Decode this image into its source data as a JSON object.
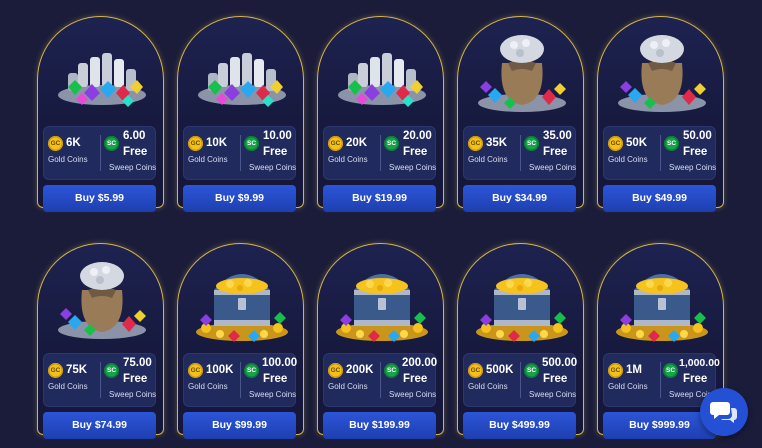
{
  "packages": [
    {
      "gc_amount": "6K",
      "gc_label": "Gold Coins",
      "sc_amount": "6.00",
      "sc_free": "Free",
      "sc_label": "Sweep Coins",
      "buy_label": "Buy $5.99",
      "art": "gems-pile"
    },
    {
      "gc_amount": "10K",
      "gc_label": "Gold Coins",
      "sc_amount": "10.00",
      "sc_free": "Free",
      "sc_label": "Sweep Coins",
      "buy_label": "Buy $9.99",
      "art": "gems-pile"
    },
    {
      "gc_amount": "20K",
      "gc_label": "Gold Coins",
      "sc_amount": "20.00",
      "sc_free": "Free",
      "sc_label": "Sweep Coins",
      "buy_label": "Buy $19.99",
      "art": "gems-pile"
    },
    {
      "gc_amount": "35K",
      "gc_label": "Gold Coins",
      "sc_amount": "35.00",
      "sc_free": "Free",
      "sc_label": "Sweep Coins",
      "buy_label": "Buy $34.99",
      "art": "gem-sack"
    },
    {
      "gc_amount": "50K",
      "gc_label": "Gold Coins",
      "sc_amount": "50.00",
      "sc_free": "Free",
      "sc_label": "Sweep Coins",
      "buy_label": "Buy $49.99",
      "art": "gem-sack"
    },
    {
      "gc_amount": "75K",
      "gc_label": "Gold Coins",
      "sc_amount": "75.00",
      "sc_free": "Free",
      "sc_label": "Sweep Coins",
      "buy_label": "Buy $74.99",
      "art": "gem-sack"
    },
    {
      "gc_amount": "100K",
      "gc_label": "Gold Coins",
      "sc_amount": "100.00",
      "sc_free": "Free",
      "sc_label": "Sweep Coins",
      "buy_label": "Buy $99.99",
      "art": "treasure-chest"
    },
    {
      "gc_amount": "200K",
      "gc_label": "Gold Coins",
      "sc_amount": "200.00",
      "sc_free": "Free",
      "sc_label": "Sweep Coins",
      "buy_label": "Buy $199.99",
      "art": "treasure-chest"
    },
    {
      "gc_amount": "500K",
      "gc_label": "Gold Coins",
      "sc_amount": "500.00",
      "sc_free": "Free",
      "sc_label": "Sweep Coins",
      "buy_label": "Buy $499.99",
      "art": "treasure-chest"
    },
    {
      "gc_amount": "1M",
      "gc_label": "Gold Coins",
      "sc_amount": "1,000.00",
      "sc_free": "Free",
      "sc_label": "Sweep Coins",
      "buy_label": "Buy $999.99",
      "art": "treasure-chest"
    }
  ],
  "coin_badges": {
    "gold": "GC",
    "sweep": "SC"
  },
  "chat_button": {
    "icon": "chat-bubbles-icon"
  },
  "colors": {
    "background": "#1a1c3a",
    "card_border": "#d6b64a",
    "buy_button": "#2450d6",
    "gold_coin": "#f2c21b",
    "sweep_coin": "#16a34a"
  }
}
